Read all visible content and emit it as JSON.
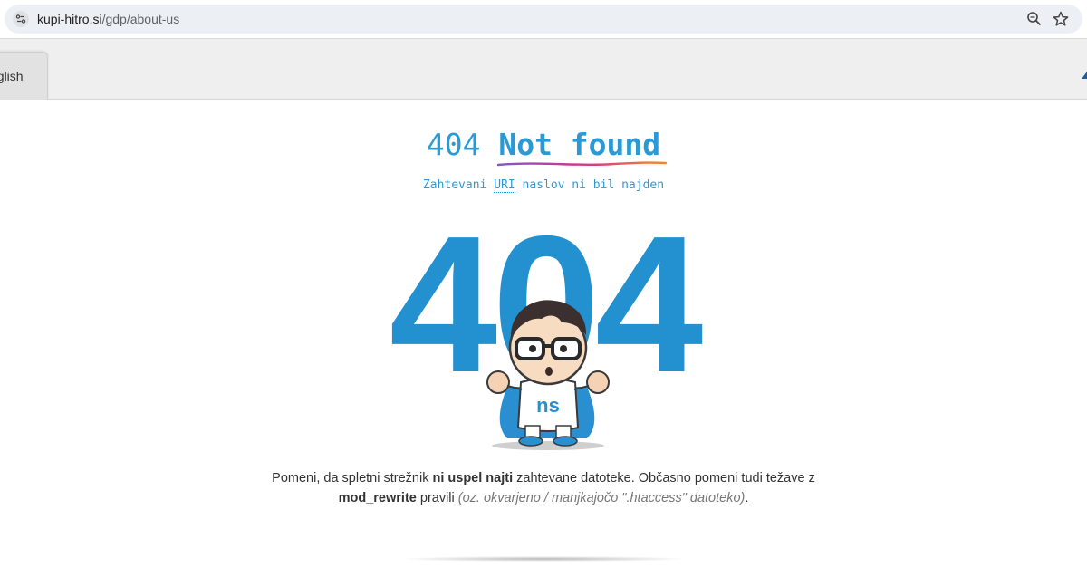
{
  "browser": {
    "url_host": "kupi-hitro.si",
    "url_path": "/gdp/about-us"
  },
  "language_tab": {
    "label": "nglish"
  },
  "error": {
    "title_code": "404",
    "title_text": "Not found",
    "subtitle_before": "Zahtevani",
    "subtitle_uri": "URI",
    "subtitle_after": "naslov ni bil najden",
    "big_code": "404",
    "mascot_badge": "ns"
  },
  "message": {
    "part1": "Pomeni, da spletni strežnik",
    "bold1": "ni uspel najti",
    "part2": "zahtevane datoteke. Občasno pomeni tudi težave z",
    "bold2": "mod_rewrite",
    "part3": "pravili",
    "italic": "(oz. okvarjeno / manjkajočo \".htaccess\" datoteko)",
    "end": "."
  },
  "colors": {
    "accent_blue": "#2a9ad6",
    "big_404_blue": "#2390d0"
  },
  "icons": [
    "site-info-icon",
    "zoom-icon",
    "star-icon"
  ]
}
